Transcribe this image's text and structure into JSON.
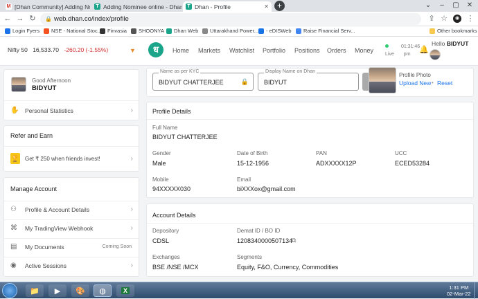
{
  "browser": {
    "tabs": [
      {
        "label": "[Dhan Community] Adding Nomi...",
        "favicon": "gmail-icon",
        "color": "#d93025",
        "glyph": "M"
      },
      {
        "label": "Adding Nominee online - Dhan Kn...",
        "favicon": "dhan-kb-icon",
        "color": "#1aa58b",
        "glyph": "T"
      },
      {
        "label": "Dhan - Profile",
        "favicon": "dhan-icon",
        "color": "#1aa58b",
        "glyph": "T"
      }
    ],
    "url": "web.dhan.co/index/profile",
    "bookmarks": [
      {
        "label": "Login Fyers",
        "color": "#1a73e8"
      },
      {
        "label": "NSE - National Stoc...",
        "color": "#f4511e"
      },
      {
        "label": "Finvasia",
        "color": "#333333"
      },
      {
        "label": "SHOONYA",
        "color": "#555555"
      },
      {
        "label": "Dhan Web",
        "color": "#1aa58b"
      },
      {
        "label": "Uttarakhand Power...",
        "color": "#888888"
      },
      {
        "label": "- eDISWeb",
        "color": "#1a73e8"
      },
      {
        "label": "Raise Financial Serv...",
        "color": "#4285f4"
      }
    ],
    "other_bookmarks": "Other bookmarks"
  },
  "app": {
    "ticker": {
      "name": "Nifty 50",
      "value": "16,533.70",
      "change": "-260.20 (-1.55%)"
    },
    "logo_glyph": "ध",
    "nav": [
      "Home",
      "Markets",
      "Watchlist",
      "Portfolio",
      "Positions",
      "Orders",
      "Money"
    ],
    "time": "01:31:46",
    "live": "Live",
    "pm": "pm",
    "greeting_hello": "Hello",
    "user_name": "BIDYUT"
  },
  "sidebar": {
    "greeting": "Good Afternoon",
    "user": "BIDYUT",
    "personal_statistics": "Personal Statistics",
    "refer_title": "Refer and Earn",
    "refer_text": "Get ₹ 250 when friends invest!",
    "manage_title": "Manage Account",
    "items": [
      {
        "label": "Profile & Account Details",
        "icon": "user-icon",
        "glyph": "⚇",
        "extra": ""
      },
      {
        "label": "My TradingView Webhook",
        "icon": "webhook-icon",
        "glyph": "⌘",
        "extra": ""
      },
      {
        "label": "My Documents",
        "icon": "document-icon",
        "glyph": "▤",
        "extra": "Coming Soon"
      },
      {
        "label": "Active Sessions",
        "icon": "sessions-icon",
        "glyph": "◉",
        "extra": ""
      }
    ]
  },
  "profile_top": {
    "kyc_label": "Name as per KYC",
    "kyc_value": "BIDYUT CHATTERJEE",
    "display_label": "Display Name on Dhan",
    "display_value": "BIDYUT",
    "photo_label": "Profile Photo",
    "upload": "Upload New",
    "reset": "Reset"
  },
  "profile_details": {
    "title": "Profile Details",
    "full_name_label": "Full Name",
    "full_name": "BIDYUT CHATTERJEE",
    "gender_label": "Gender",
    "gender": "Male",
    "dob_label": "Date of Birth",
    "dob": "15-12-1956",
    "pan_label": "PAN",
    "pan": "ADXXXXX12P",
    "ucc_label": "UCC",
    "ucc": "ECED53284",
    "mobile_label": "Mobile",
    "mobile": "94XXXXX030",
    "email_label": "Email",
    "email": "biXXXox@gmail.com"
  },
  "account_details": {
    "title": "Account Details",
    "depository_label": "Depository",
    "depository": "CDSL",
    "demat_label": "Demat ID / BO ID",
    "demat": "1208340000507134",
    "exchanges_label": "Exchanges",
    "exchanges": "BSE /NSE /MCX",
    "segments_label": "Segments",
    "segments": "Equity, F&O, Currency, Commodities"
  },
  "taskbar": {
    "time": "1:31 PM",
    "date": "02-Mar-22"
  }
}
